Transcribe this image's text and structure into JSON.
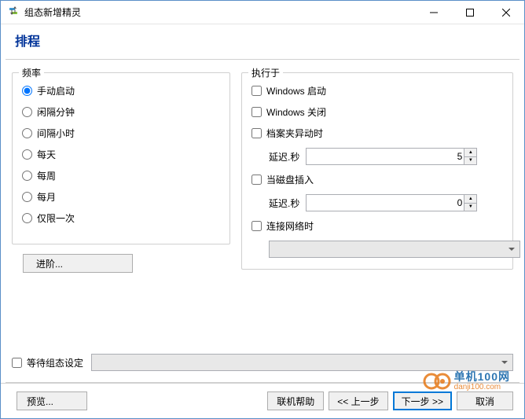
{
  "window": {
    "title": "组态新增精灵"
  },
  "header": {
    "title": "排程"
  },
  "frequency": {
    "groupTitle": "频率",
    "options": {
      "manual": "手动启动",
      "intervalMin": "闲隔分钟",
      "intervalHour": "间隔小时",
      "daily": "每天",
      "weekly": "每周",
      "monthly": "每月",
      "once": "仅限一次"
    },
    "advancedButton": "进阶..."
  },
  "runOn": {
    "groupTitle": "执行于",
    "windowsStartup": "Windows 启动",
    "windowsShutdown": "Windows 关闭",
    "folderChanged": "档案夹异动时",
    "delayLabel1": "延迟.秒",
    "delayValue1": "5",
    "diskInserted": "当磁盘插入",
    "delayLabel2": "延迟.秒",
    "delayValue2": "0",
    "networkConnected": "连接网络时"
  },
  "waitRow": {
    "label": "等待组态设定"
  },
  "footer": {
    "preview": "预览...",
    "onlineHelp": "联机帮助",
    "prev": "<< 上一步",
    "next": "下一步 >>",
    "cancel": "取消"
  },
  "watermark": {
    "cn": "单机100网",
    "url": "danji100.com"
  }
}
